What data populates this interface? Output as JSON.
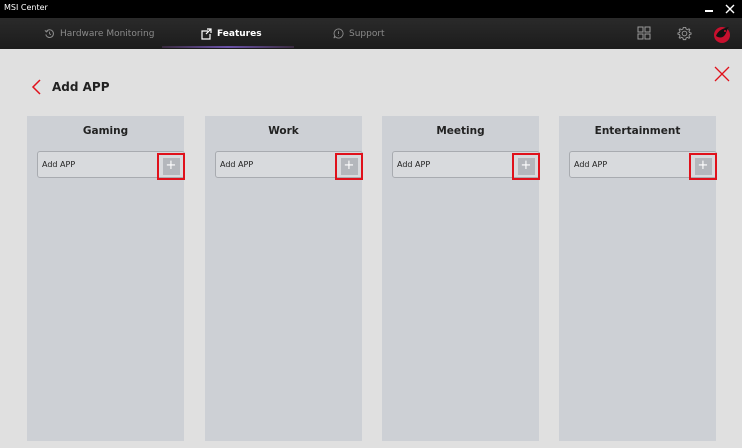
{
  "window": {
    "title": "MSI Center"
  },
  "nav": {
    "tabs": [
      {
        "label": "Hardware Monitoring",
        "icon": "refresh-circle-icon",
        "active": false
      },
      {
        "label": "Features",
        "icon": "share-square-icon",
        "active": true
      },
      {
        "label": "Support",
        "icon": "chat-bubble-icon",
        "active": false
      }
    ],
    "right_icons": [
      "grid-icon",
      "gear-icon",
      "dragon-logo-icon"
    ]
  },
  "page": {
    "title": "Add APP"
  },
  "columns": [
    {
      "title": "Gaming",
      "field_label": "Add APP",
      "button_symbol": "+"
    },
    {
      "title": "Work",
      "field_label": "Add APP",
      "button_symbol": "+"
    },
    {
      "title": "Meeting",
      "field_label": "Add APP",
      "button_symbol": "+"
    },
    {
      "title": "Entertainment",
      "field_label": "Add APP",
      "button_symbol": "+"
    }
  ],
  "colors": {
    "accent_red": "#e0111b",
    "tab_underline": "#6b52a8",
    "column_bg": "#cdd0d5",
    "page_bg": "#e0e0e0"
  }
}
